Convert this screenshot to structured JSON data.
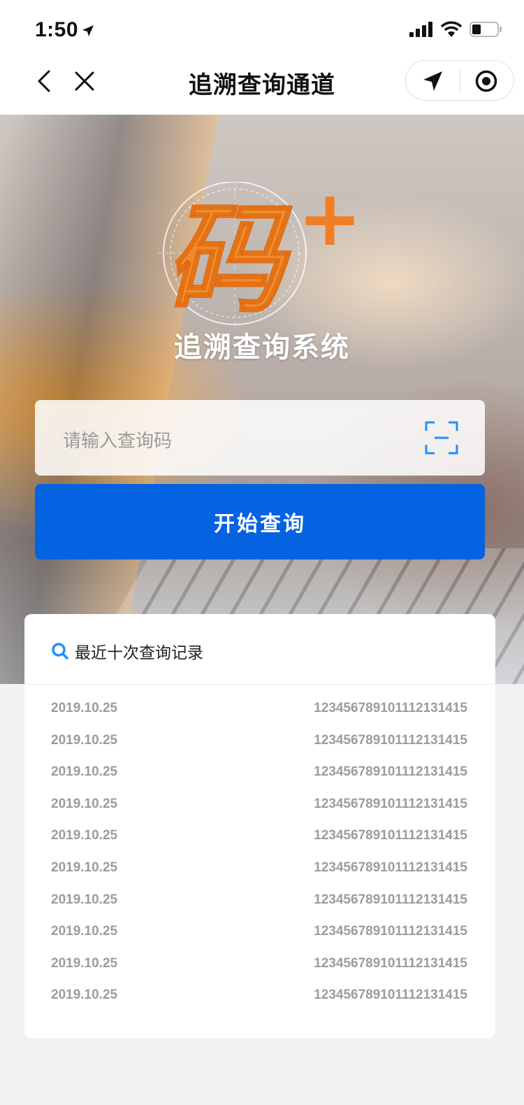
{
  "status_bar": {
    "time": "1:50"
  },
  "nav": {
    "title": "追溯查询通道"
  },
  "hero": {
    "logo_text": "码",
    "logo_plus": "+",
    "title": "追溯查询系统"
  },
  "search": {
    "placeholder": "请输入查询码"
  },
  "query_button": {
    "label": "开始查询"
  },
  "history": {
    "title": "最近十次查询记录",
    "rows": [
      {
        "date": "2019.10.25",
        "code": "123456789101112131415"
      },
      {
        "date": "2019.10.25",
        "code": "123456789101112131415"
      },
      {
        "date": "2019.10.25",
        "code": "123456789101112131415"
      },
      {
        "date": "2019.10.25",
        "code": "123456789101112131415"
      },
      {
        "date": "2019.10.25",
        "code": "123456789101112131415"
      },
      {
        "date": "2019.10.25",
        "code": "123456789101112131415"
      },
      {
        "date": "2019.10.25",
        "code": "123456789101112131415"
      },
      {
        "date": "2019.10.25",
        "code": "123456789101112131415"
      },
      {
        "date": "2019.10.25",
        "code": "123456789101112131415"
      },
      {
        "date": "2019.10.25",
        "code": "123456789101112131415"
      }
    ]
  },
  "colors": {
    "primary": "#0562e0",
    "logo_orange": "#f08a2a",
    "scan_blue": "#1e90ff",
    "muted_text": "#9c9c9c"
  }
}
